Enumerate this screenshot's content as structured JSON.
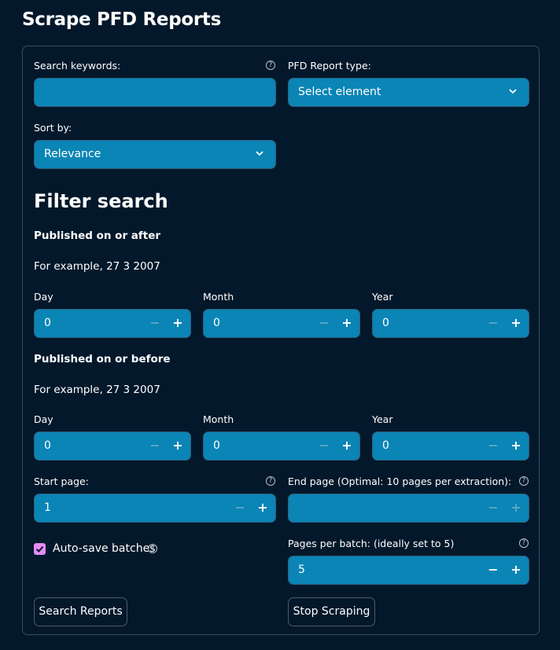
{
  "page": {
    "title": "Scrape PFD Reports"
  },
  "search": {
    "keywords_label": "Search keywords:",
    "keywords_value": "",
    "report_type_label": "PFD Report type:",
    "report_type_value": "Select element",
    "sort_label": "Sort by:",
    "sort_value": "Relevance"
  },
  "filter": {
    "heading": "Filter search",
    "after": {
      "heading": "Published on or after",
      "example": "For example, 27 3 2007",
      "day_label": "Day",
      "day_value": "0",
      "month_label": "Month",
      "month_value": "0",
      "year_label": "Year",
      "year_value": "0"
    },
    "before": {
      "heading": "Published on or before",
      "example": "For example, 27 3 2007",
      "day_label": "Day",
      "day_value": "0",
      "month_label": "Month",
      "month_value": "0",
      "year_label": "Year",
      "year_value": "0"
    }
  },
  "pages": {
    "start_label": "Start page:",
    "start_value": "1",
    "end_label": "End page (Optimal: 10 pages per extraction):",
    "end_value": "",
    "autosave_label": "Auto-save batches",
    "autosave_checked": true,
    "batch_label": "Pages per batch: (ideally set to 5)",
    "batch_value": "5"
  },
  "actions": {
    "search_label": "Search Reports",
    "stop_label": "Stop Scraping"
  },
  "glyphs": {
    "minus": "−",
    "plus": "+",
    "help": "?",
    "check": "✓"
  },
  "colors": {
    "background": "#04182b",
    "field": "#0a85b5",
    "checkbox": "#e58bf5"
  }
}
